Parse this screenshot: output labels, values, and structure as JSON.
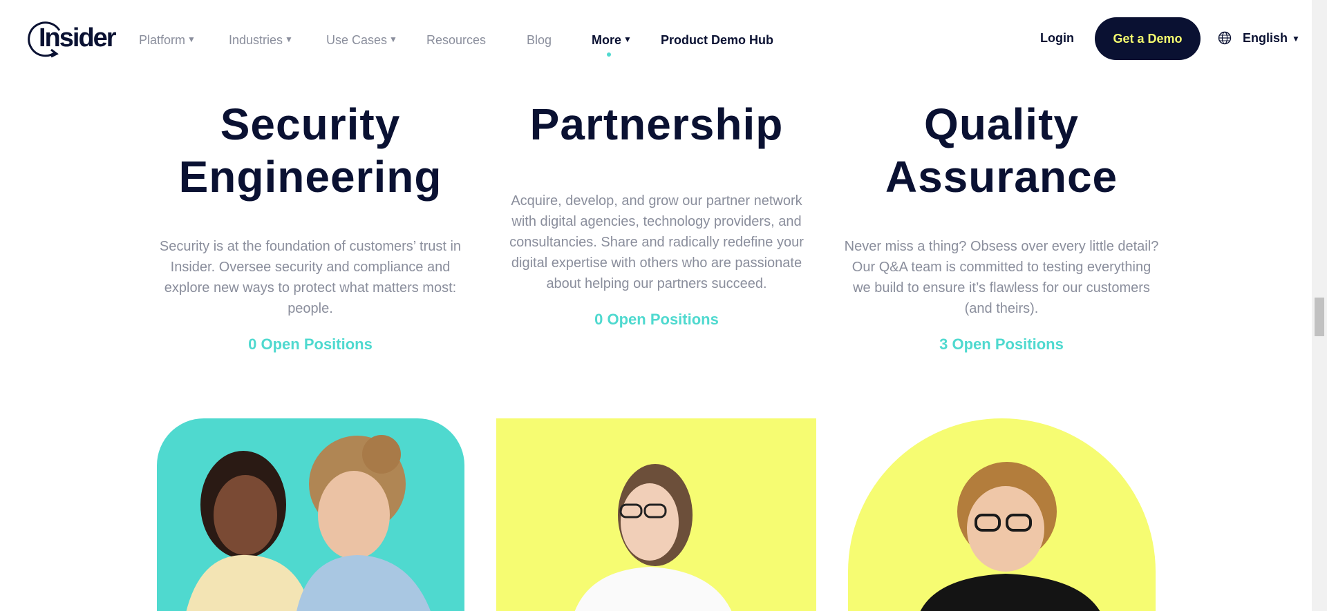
{
  "header": {
    "logo_text": "Insider",
    "nav": [
      {
        "label": "Platform"
      },
      {
        "label": "Industries"
      },
      {
        "label": "Use Cases"
      },
      {
        "label": "Resources"
      },
      {
        "label": "Blog"
      },
      {
        "label": "More"
      },
      {
        "label": "Product Demo Hub"
      }
    ],
    "login_label": "Login",
    "cta_label": "Get a Demo",
    "language_label": "English"
  },
  "columns": [
    {
      "title_line1": "Security",
      "title_line2": "Engineering",
      "description": "Security is at the foundation of customers’ trust in Insider. Oversee security and compliance and explore new ways to protect what matters most: people.",
      "positions_label": "0 Open Positions"
    },
    {
      "title_line1": "Partnership",
      "description": "Acquire, develop, and grow our partner network with digital agencies, technology providers, and consultancies. Share and radically redefine your digital expertise with others who are passionate about helping our partners succeed.",
      "positions_label": "0 Open Positions"
    },
    {
      "title_line1": "Quality",
      "title_line2": "Assurance",
      "description": "Never miss a thing? Obsess over every little detail? Our Q&A team is committed to testing everything we build to ensure it’s flawless for our customers (and theirs).",
      "positions_label": "3 Open Positions"
    }
  ],
  "colors": {
    "navy": "#0a1132",
    "teal": "#4fd9cf",
    "yellow": "#f6fc72",
    "gray_text": "#8a8e9c"
  },
  "icons": {
    "globe": "globe-icon",
    "caret": "caret-down-icon"
  }
}
